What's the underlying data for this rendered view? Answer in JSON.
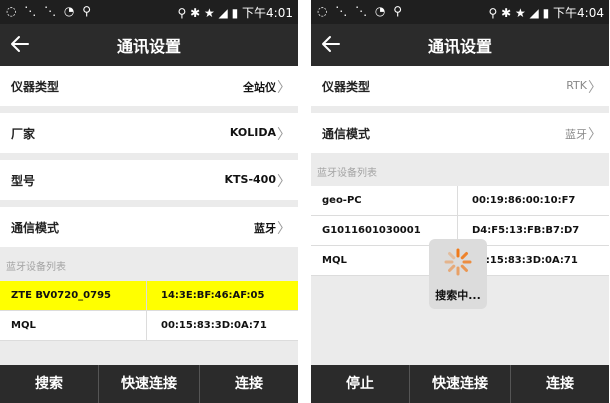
{
  "status_left": {
    "icons_text": "◌ ⋱ ⋱ ◔ ⚲",
    "icon_names": [
      "sync-icon",
      "signal-mute-icon",
      "signal-mute-icon",
      "wifi-icon",
      "usb-icon"
    ]
  },
  "left": {
    "time": "下午4:01",
    "title": "通讯设置",
    "rows": [
      {
        "label": "仪器类型",
        "value": "全站仪"
      },
      {
        "label": "厂家",
        "value": "KOLIDA"
      },
      {
        "label": "型号",
        "value": "KTS-400"
      },
      {
        "label": "通信模式",
        "value": "蓝牙"
      }
    ],
    "list_label": "蓝牙设备列表",
    "devices": [
      {
        "name": "ZTE BV0720_0795",
        "mac": "14:3E:BF:46:AF:05",
        "selected": true
      },
      {
        "name": "MQL",
        "mac": "00:15:83:3D:0A:71",
        "selected": false
      }
    ],
    "buttons": [
      "搜索",
      "快速连接",
      "连接"
    ]
  },
  "right": {
    "time": "下午4:04",
    "title": "通讯设置",
    "rows": [
      {
        "label": "仪器类型",
        "value": "RTK"
      },
      {
        "label": "通信模式",
        "value": "蓝牙"
      }
    ],
    "list_label": "蓝牙设备列表",
    "devices": [
      {
        "name": "geo-PC",
        "mac": "00:19:86:00:10:F7"
      },
      {
        "name": "G1011601030001",
        "mac": "D4:F5:13:FB:B7:D7"
      },
      {
        "name": "MQL",
        "mac": "00:15:83:3D:0A:71"
      }
    ],
    "loading_text": "搜索中...",
    "buttons": [
      "停止",
      "快速连接",
      "连接"
    ]
  },
  "colors": {
    "highlight": "#ffff00",
    "bar": "#2b2b2b",
    "spinner": "#f07a1a"
  }
}
